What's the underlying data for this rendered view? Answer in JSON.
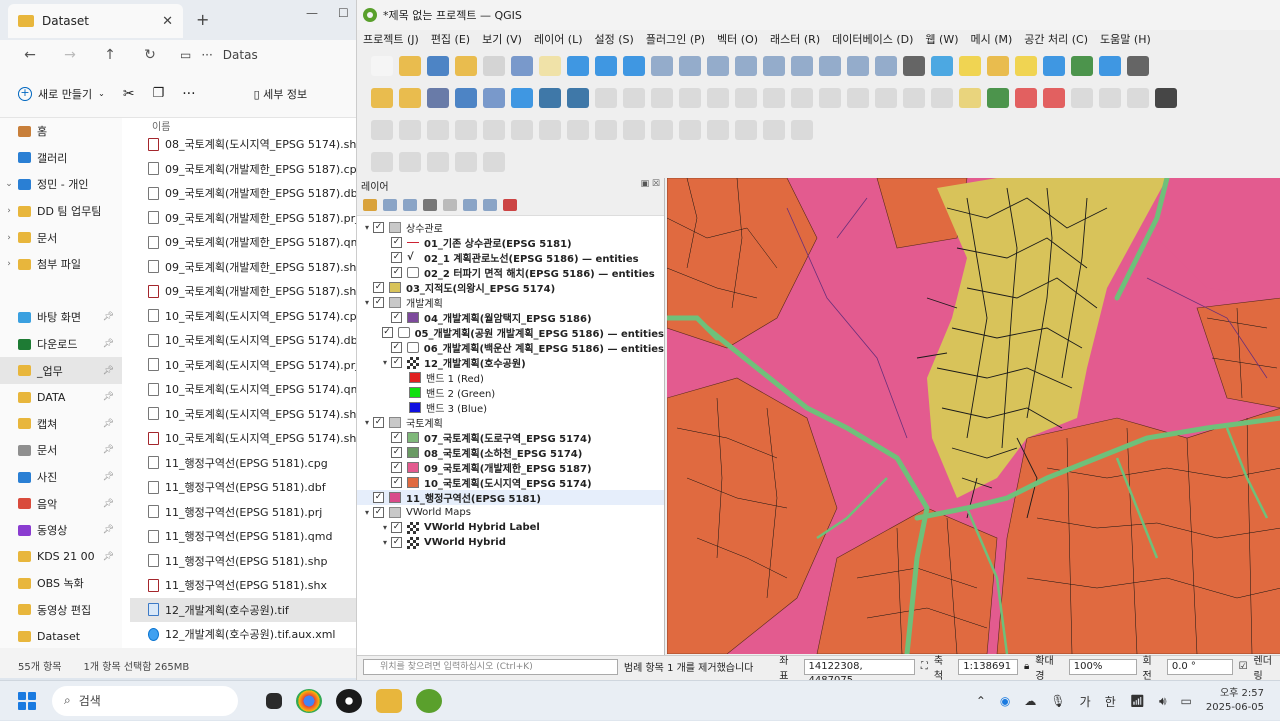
{
  "explorer": {
    "tab_title": "Dataset",
    "address_crumb": "Datas",
    "toolbar": {
      "new_label": "새로 만들기",
      "details_label": "세부 정보"
    },
    "sidebar": [
      {
        "label": "홈",
        "color": "#c87f3a",
        "pinned": false,
        "chev": ""
      },
      {
        "label": "갤러리",
        "color": "#2a7fd4",
        "pinned": false,
        "chev": ""
      },
      {
        "label": "정민 - 개인",
        "color": "#2a7fd4",
        "pinned": false,
        "chev": "v"
      },
      {
        "label": "DD 팀 업무팀",
        "color": "#e8b63c",
        "pinned": false,
        "chev": ">"
      },
      {
        "label": "문서",
        "color": "#e8b63c",
        "pinned": false,
        "chev": ">"
      },
      {
        "label": "첨부 파일",
        "color": "#e8b63c",
        "pinned": false,
        "chev": ">"
      },
      {
        "label": "",
        "color": "",
        "pinned": false,
        "chev": ""
      },
      {
        "label": "바탕 화면",
        "color": "#3aa0e0",
        "pinned": true,
        "chev": ""
      },
      {
        "label": "다운로드",
        "color": "#1e7b34",
        "pinned": true,
        "chev": ""
      },
      {
        "label": "_업무",
        "color": "#e8b63c",
        "pinned": true,
        "chev": ""
      },
      {
        "label": "DATA",
        "color": "#e8b63c",
        "pinned": true,
        "chev": ""
      },
      {
        "label": "캡쳐",
        "color": "#e8b63c",
        "pinned": true,
        "chev": ""
      },
      {
        "label": "문서",
        "color": "#8f8f8f",
        "pinned": true,
        "chev": ""
      },
      {
        "label": "사진",
        "color": "#2a7fd4",
        "pinned": true,
        "chev": ""
      },
      {
        "label": "음악",
        "color": "#d94b3c",
        "pinned": true,
        "chev": ""
      },
      {
        "label": "동영상",
        "color": "#8a3cd0",
        "pinned": true,
        "chev": ""
      },
      {
        "label": "KDS 21 00",
        "color": "#e8b63c",
        "pinned": true,
        "chev": ""
      },
      {
        "label": "OBS 녹화",
        "color": "#e8b63c",
        "pinned": false,
        "chev": ""
      },
      {
        "label": "동영상 편집",
        "color": "#e8b63c",
        "pinned": false,
        "chev": ""
      },
      {
        "label": "Dataset",
        "color": "#e8b63c",
        "pinned": false,
        "chev": ""
      }
    ],
    "list_header": "이름",
    "files": [
      {
        "name": "08_국토계획(도시지역_EPSG 5174).shx",
        "kind": "shx"
      },
      {
        "name": "09_국토계획(개발제한_EPSG 5187).cpg",
        "kind": "doc"
      },
      {
        "name": "09_국토계획(개발제한_EPSG 5187).dbf",
        "kind": "doc"
      },
      {
        "name": "09_국토계획(개발제한_EPSG 5187).prj",
        "kind": "doc"
      },
      {
        "name": "09_국토계획(개발제한_EPSG 5187).qmd",
        "kind": "doc"
      },
      {
        "name": "09_국토계획(개발제한_EPSG 5187).shp",
        "kind": "shp"
      },
      {
        "name": "09_국토계획(개발제한_EPSG 5187).shx",
        "kind": "shx"
      },
      {
        "name": "10_국토계획(도시지역_EPSG 5174).cpg",
        "kind": "doc"
      },
      {
        "name": "10_국토계획(도시지역_EPSG 5174).dbf",
        "kind": "doc"
      },
      {
        "name": "10_국토계획(도시지역_EPSG 5174).prj",
        "kind": "doc"
      },
      {
        "name": "10_국토계획(도시지역_EPSG 5174).qmd",
        "kind": "doc"
      },
      {
        "name": "10_국토계획(도시지역_EPSG 5174).shp",
        "kind": "shp"
      },
      {
        "name": "10_국토계획(도시지역_EPSG 5174).shx",
        "kind": "shx"
      },
      {
        "name": "11_행정구역선(EPSG 5181).cpg",
        "kind": "doc"
      },
      {
        "name": "11_행정구역선(EPSG 5181).dbf",
        "kind": "doc"
      },
      {
        "name": "11_행정구역선(EPSG 5181).prj",
        "kind": "doc"
      },
      {
        "name": "11_행정구역선(EPSG 5181).qmd",
        "kind": "doc"
      },
      {
        "name": "11_행정구역선(EPSG 5181).shp",
        "kind": "shp"
      },
      {
        "name": "11_행정구역선(EPSG 5181).shx",
        "kind": "shx"
      },
      {
        "name": "12_개발계획(호수공원).tif",
        "kind": "tif",
        "selected": true
      },
      {
        "name": "12_개발계획(호수공원).tif.aux.xml",
        "kind": "xml"
      }
    ],
    "status": {
      "count": "55개 항목",
      "selection": "1개 항목 선택함 265MB"
    }
  },
  "qgis": {
    "title": "*제목 없는 프로젝트 — QGIS",
    "menu": [
      "프로젝트 (J)",
      "편집 (E)",
      "보기 (V)",
      "레이어 (L)",
      "설정 (S)",
      "플러그인 (P)",
      "벡터 (O)",
      "래스터 (R)",
      "데이터베이스 (D)",
      "웹 (W)",
      "메시 (M)",
      "공간 처리 (C)",
      "도움말 (H)"
    ],
    "layers_panel_title": "레이어",
    "layers": [
      {
        "label": "상수관로",
        "type": "group",
        "level": 0,
        "exp": "v",
        "bold": false
      },
      {
        "label": "01_기존 상수관로(EPSG 5181)",
        "type": "line",
        "level": 1,
        "exp": "",
        "bold": true
      },
      {
        "label": "02_1 계획관로노선(EPSG 5186) — entities",
        "type": "vline",
        "level": 1,
        "exp": "",
        "bold": true
      },
      {
        "label": "02_2 터파기 면적 해치(EPSG 5186) — entities",
        "type": "poly-outline",
        "level": 1,
        "exp": "",
        "bold": true
      },
      {
        "label": "03_지적도(의왕시_EPSG 5174)",
        "type": "swatch",
        "color": "#d8c35a",
        "level": 0,
        "exp": "",
        "bold": true
      },
      {
        "label": "개발계획",
        "type": "group",
        "level": 0,
        "exp": "v",
        "bold": false
      },
      {
        "label": "04_개발계획(월암택지_EPSG 5186)",
        "type": "swatch",
        "color": "#7d4a9c",
        "level": 1,
        "exp": "",
        "bold": true
      },
      {
        "label": "05_개발계획(공원 개발계획_EPSG 5186) — entities",
        "type": "poly-outline",
        "level": 1,
        "exp": "",
        "bold": true
      },
      {
        "label": "06_개발계획(백운산 계획_EPSG 5186) — entities",
        "type": "poly-outline",
        "level": 1,
        "exp": "",
        "bold": true
      },
      {
        "label": "12_개발계획(호수공원)",
        "type": "raster",
        "level": 1,
        "exp": "v",
        "bold": true
      },
      {
        "label": "밴드 1 (Red)",
        "type": "band",
        "color": "#e02020",
        "level": 2,
        "exp": "",
        "bold": false
      },
      {
        "label": "밴드 2 (Green)",
        "type": "band",
        "color": "#10e010",
        "level": 2,
        "exp": "",
        "bold": false
      },
      {
        "label": "밴드 3 (Blue)",
        "type": "band",
        "color": "#1010e0",
        "level": 2,
        "exp": "",
        "bold": false
      },
      {
        "label": "국토계획",
        "type": "group",
        "level": 0,
        "exp": "v",
        "bold": false
      },
      {
        "label": "07_국토계획(도로구역_EPSG 5174)",
        "type": "swatch",
        "color": "#7fb87a",
        "level": 1,
        "exp": "",
        "bold": true
      },
      {
        "label": "08_국토계획(소하천_EPSG 5174)",
        "type": "swatch",
        "color": "#6a9a64",
        "level": 1,
        "exp": "",
        "bold": true
      },
      {
        "label": "09_국토계획(개발제한_EPSG 5187)",
        "type": "swatch",
        "color": "#e35b8f",
        "level": 1,
        "exp": "",
        "bold": true
      },
      {
        "label": "10_국토계획(도시지역_EPSG 5174)",
        "type": "swatch",
        "color": "#e06a40",
        "level": 1,
        "exp": "",
        "bold": true
      },
      {
        "label": "11_행정구역선(EPSG 5181)",
        "type": "swatch",
        "color": "#d94b8a",
        "level": 0,
        "exp": "",
        "bold": true,
        "selected": true
      },
      {
        "label": "VWorld Maps",
        "type": "group",
        "level": 0,
        "exp": "v",
        "bold": false
      },
      {
        "label": "VWorld Hybrid Label",
        "type": "raster",
        "level": 1,
        "exp": "v",
        "bold": true
      },
      {
        "label": "VWorld Hybrid",
        "type": "raster",
        "level": 1,
        "exp": "v",
        "bold": true
      }
    ],
    "status": {
      "search_placeholder": "위치를 찾으려면 입력하십시오 (Ctrl+K)",
      "message": "범례 항목 1 개를 제거했습니다",
      "coord_label": "좌표",
      "coord_value": "14122308, 4487075",
      "scale_label": "축척",
      "scale_value": "1:138691",
      "magnifier_label": "확대경",
      "magnifier_value": "100%",
      "rotation_label": "회전",
      "rotation_value": "0.0 °",
      "render_label": "렌더링"
    }
  },
  "taskbar": {
    "search_label": "검색",
    "ime_label": "가",
    "ime2_label": "한",
    "time": "오후 2:57",
    "date": "2025-06-05"
  }
}
